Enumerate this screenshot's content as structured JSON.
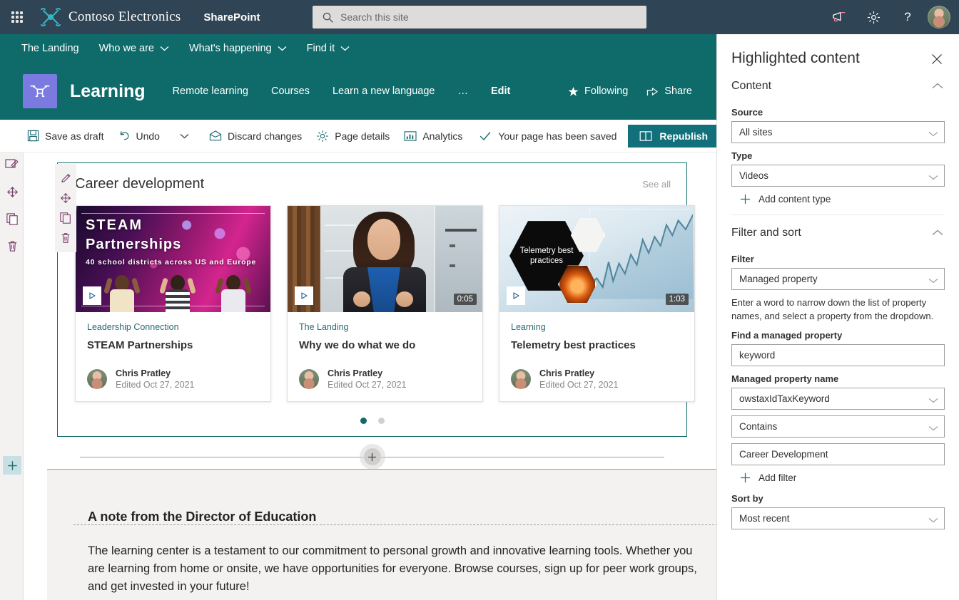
{
  "suite": {
    "waffle": "app-launcher",
    "brand": "Contoso Electronics",
    "app": "SharePoint",
    "search_placeholder": "Search this site",
    "icons": [
      "megaphone-icon",
      "gear-icon",
      "help-icon",
      "avatar"
    ]
  },
  "hubnav": {
    "items": [
      {
        "label": "The Landing",
        "chevron": false
      },
      {
        "label": "Who we are",
        "chevron": true
      },
      {
        "label": "What's happening",
        "chevron": true
      },
      {
        "label": "Find it",
        "chevron": true
      }
    ]
  },
  "site": {
    "logo": "drone-icon",
    "title": "Learning",
    "nav": [
      "Remote learning",
      "Courses",
      "Learn a new language",
      "…",
      "Edit"
    ],
    "following_label": "Following",
    "share_label": "Share"
  },
  "commandbar": {
    "save_draft": "Save as draft",
    "undo": "Undo",
    "discard": "Discard changes",
    "page_details": "Page details",
    "analytics": "Analytics",
    "status": "Your page has been saved",
    "republish": "Republish"
  },
  "rail": {
    "icons": [
      "edit-section-icon",
      "move-section-icon",
      "duplicate-section-icon",
      "delete-section-icon"
    ],
    "add_section": "+"
  },
  "webpart": {
    "toolbar_icons": [
      "edit-webpart-icon",
      "move-webpart-icon",
      "duplicate-webpart-icon",
      "delete-webpart-icon"
    ],
    "title": "Career development",
    "see_all": "See all",
    "cards": [
      {
        "thumb": "steam-partnerships-thumbnail",
        "overlay_title": "STEAM",
        "overlay_title2": "Partnerships",
        "overlay_sub": "40 school districts across US and Europe",
        "duration": "",
        "site": "Leadership Connection",
        "name": "STEAM Partnerships",
        "author": "Chris Pratley",
        "edited": "Edited Oct 27, 2021"
      },
      {
        "thumb": "why-we-do-what-we-do-thumbnail",
        "duration": "0:05",
        "site": "The Landing",
        "name": "Why we do what we do",
        "author": "Chris Pratley",
        "edited": "Edited Oct 27, 2021"
      },
      {
        "thumb": "telemetry-best-practices-thumbnail",
        "overlay_title": "Telemetry best practices",
        "duration": "1:03",
        "site": "Learning",
        "name": "Telemetry best practices",
        "author": "Chris Pratley",
        "edited": "Edited Oct 27, 2021"
      }
    ],
    "pager": {
      "count": 2,
      "active": 0
    }
  },
  "lower_section": {
    "note_title": "A note from the Director of Education",
    "note_body": "The learning center is a testament to our commitment to personal growth and innovative learning tools. Whether you are learning from home or onsite, we have opportunities for everyone. Browse courses, sign up for peer work groups, and get invested in your future!"
  },
  "pane": {
    "title": "Highlighted content",
    "close": "close-icon",
    "content": {
      "group_title": "Content",
      "source_label": "Source",
      "source_value": "All sites",
      "type_label": "Type",
      "type_value": "Videos",
      "add_content_type": "Add content type"
    },
    "filter_sort": {
      "group_title": "Filter and sort",
      "filter_label": "Filter",
      "filter_value": "Managed property",
      "help_text": "Enter a word to narrow down the list of property names, and select a property from the dropdown.",
      "find_label": "Find a managed property",
      "find_value": "keyword",
      "prop_label": "Managed property name",
      "prop_value": "owstaxIdTaxKeyword",
      "operator_value": "Contains",
      "operand_value": "Career Development",
      "add_filter": "Add filter",
      "sort_label": "Sort by",
      "sort_value": "Most recent"
    }
  },
  "colors": {
    "suitebar": "#2f4454",
    "teal": "#0f6a6a",
    "republish": "#11707a",
    "link": "#276a73"
  }
}
